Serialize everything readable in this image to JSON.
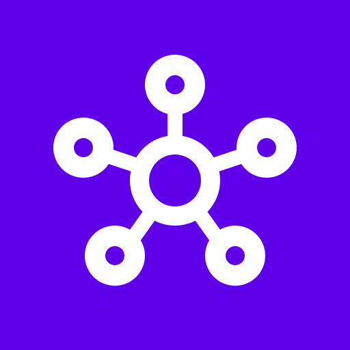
{
  "icon": {
    "name": "network-hub-icon",
    "colors": {
      "background": "#5E00EA",
      "glyph": "#FFFFFF"
    }
  }
}
